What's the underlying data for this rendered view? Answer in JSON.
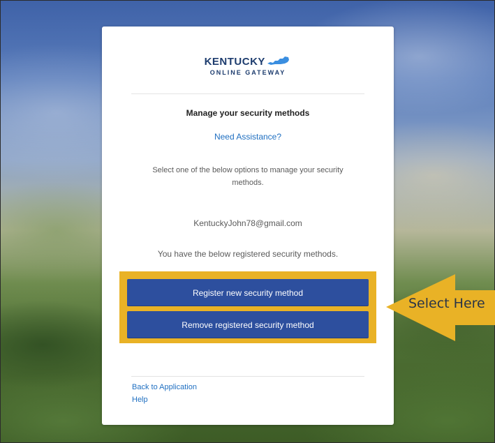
{
  "logo": {
    "brand_main": "KENTUCKY",
    "brand_sub": "ONLINE GATEWAY"
  },
  "card": {
    "heading": "Manage your security methods",
    "assistance_link": "Need Assistance?",
    "instruction": "Select one of the below options to manage your security methods.",
    "email": "KentuckyJohn78@gmail.com",
    "registered_text": "You have the below registered security methods."
  },
  "actions": {
    "register_label": "Register new security method",
    "remove_label": "Remove registered security method"
  },
  "footer": {
    "back_link": "Back to Application",
    "help_link": "Help"
  },
  "callout": {
    "label": "Select Here",
    "color": "#e9b226"
  },
  "colors": {
    "button_bg": "#2d4f9e",
    "link": "#1f6fc1",
    "brand_navy": "#1d3c6e",
    "brand_state": "#3a8ee0"
  }
}
